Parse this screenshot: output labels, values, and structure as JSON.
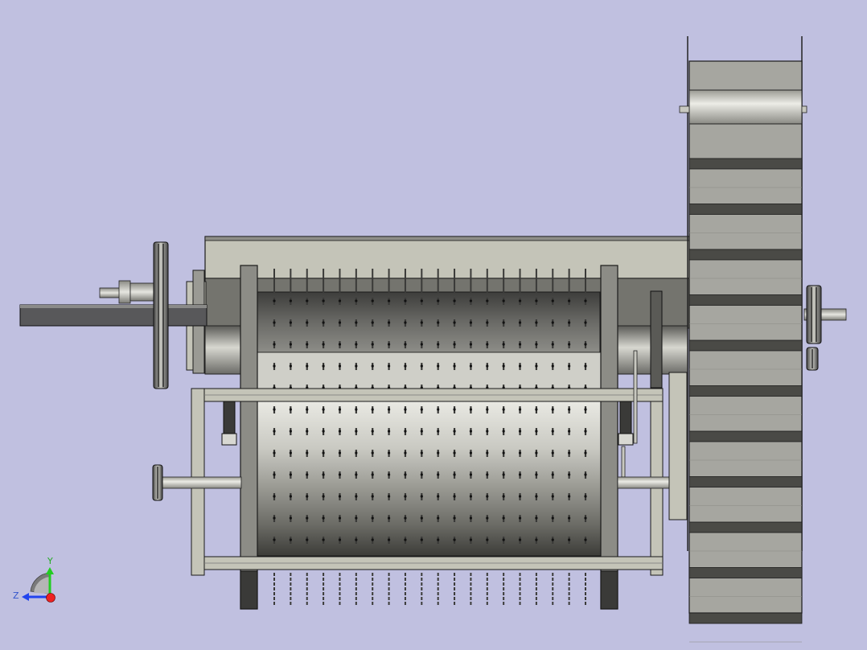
{
  "viewport": {
    "background_color": "#c0c0e0",
    "steel_color": "#c4c4b8",
    "dark_steel_color": "#3a3a38",
    "outline_color": "#1a1a1a"
  },
  "model": {
    "drum_spike_columns": 20,
    "drum_spike_rows": 12,
    "wheel_lug_count": 11
  },
  "triad": {
    "y_label": "Y",
    "z_label": "Z",
    "y_color": "#22cc22",
    "z_color": "#2244ee",
    "x_color": "#ee2222",
    "icons": [
      "axis-triad-icon"
    ]
  }
}
